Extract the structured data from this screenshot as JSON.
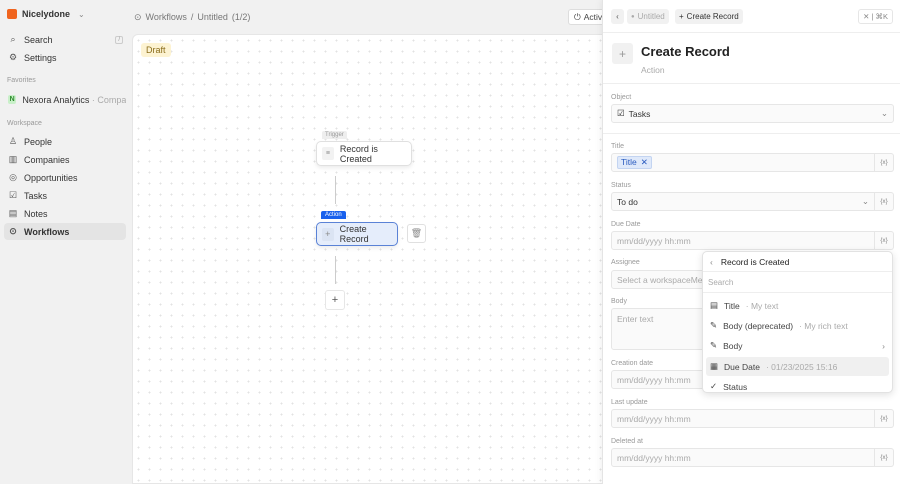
{
  "workspace": {
    "name": "Nicelydone",
    "logo_color": "#f0641e"
  },
  "sidebar": {
    "search": "Search",
    "search_shortcut": "/",
    "settings": "Settings",
    "favorites_label": "Favorites",
    "favorite": {
      "initial": "N",
      "name": "Nexora Analytics",
      "sub": "· Compa..."
    },
    "workspace_label": "Workspace",
    "items": [
      {
        "label": "People"
      },
      {
        "label": "Companies"
      },
      {
        "label": "Opportunities"
      },
      {
        "label": "Tasks"
      },
      {
        "label": "Notes"
      },
      {
        "label": "Workflows"
      }
    ]
  },
  "topbar": {
    "breadcrumb_root": "Workflows",
    "breadcrumb_sep": "/",
    "breadcrumb_page": "Untitled",
    "breadcrumb_count": "(1/2)",
    "activate": "Activ"
  },
  "canvas": {
    "status_badge": "Draft",
    "trigger_tag": "Trigger",
    "trigger_node": "Record is Created",
    "action_tag": "Action",
    "action_node": "Create Record"
  },
  "panel": {
    "nav_untitled": "Untitled",
    "nav_current": "Create Record",
    "close": "✕ | ⌘K",
    "title": "Create Record",
    "subtitle": "Action",
    "fields": {
      "object": {
        "label": "Object",
        "value": "Tasks"
      },
      "title": {
        "label": "Title",
        "chip": "Title"
      },
      "status": {
        "label": "Status",
        "value": "To do"
      },
      "due_date": {
        "label": "Due Date",
        "placeholder": "mm/dd/yyyy hh:mm"
      },
      "assignee": {
        "label": "Assignee",
        "placeholder": "Select a workspaceMember"
      },
      "body": {
        "label": "Body",
        "placeholder": "Enter text"
      },
      "creation_date": {
        "label": "Creation date",
        "placeholder": "mm/dd/yyyy hh:mm"
      },
      "last_update": {
        "label": "Last update",
        "placeholder": "mm/dd/yyyy hh:mm"
      },
      "deleted_at": {
        "label": "Deleted at",
        "placeholder": "mm/dd/yyyy hh:mm"
      }
    },
    "var_icon": "{x}"
  },
  "dropdown": {
    "header": "Record is Created",
    "search_placeholder": "Search",
    "items": [
      {
        "label": "Title",
        "sub": "· My text"
      },
      {
        "label": "Body (deprecated)",
        "sub": "· My rich text"
      },
      {
        "label": "Body",
        "sub": ""
      },
      {
        "label": "Due Date",
        "sub": "· 01/23/2025 15:16"
      },
      {
        "label": "Status",
        "sub": ""
      }
    ]
  }
}
